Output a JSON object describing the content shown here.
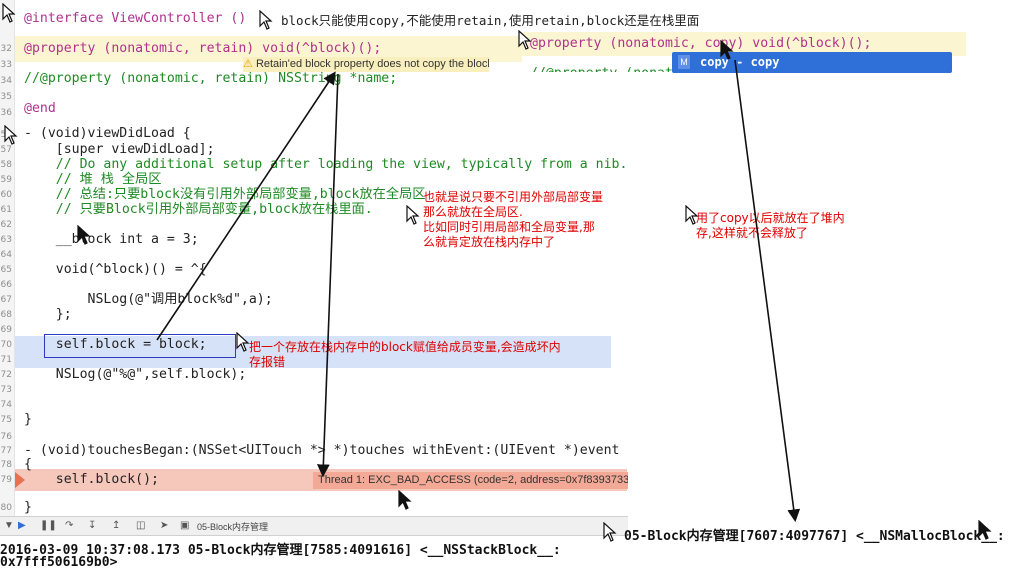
{
  "top_comment": "block只能使用copy,不能使用retain,使用retain,block还是在栈里面",
  "code_lines": {
    "l32": "@property (nonatomic, retain) void(^block)();",
    "l34": "//@property (nonatomic, retain) NSString *name;",
    "l36": "@end",
    "l56": "- (void)viewDidLoad {",
    "l57": "    [super viewDidLoad];",
    "l58": "    // Do any additional setup after loading the view, typically from a nib.",
    "l59": "    // 堆 栈 全局区",
    "l60": "    // 总结:只要block没有引用外部局部变量,block放在全局区",
    "l61": "    // 只要Block引用外部局部变量,block放在栈里面.",
    "l63": "    __block int a = 3;",
    "l65": "    void(^block)() = ^{",
    "l67": "        NSLog(@\"调用block%d\",a);",
    "l68": "    };",
    "l70": "    self.block = block;",
    "l72": "    NSLog(@\"%@\",self.block);",
    "l75": "}",
    "l77": "- (void)touchesBegan:(NSSet<UITouch *> *)touches withEvent:(UIEvent *)event",
    "l78": "{",
    "l79": "    self.block();",
    "l80": "}"
  },
  "interface_line": "@interface ViewController ()",
  "line_numbers": [
    "32",
    "33",
    "34",
    "35",
    "36",
    "56",
    "57",
    "58",
    "59",
    "60",
    "61",
    "62",
    "63",
    "64",
    "65",
    "66",
    "67",
    "68",
    "69",
    "70",
    "71",
    "72",
    "73",
    "74",
    "75",
    "76",
    "77",
    "78",
    "79",
    "80"
  ],
  "warning_text": "Retain'ed block property does not copy the block",
  "error_text": "Thread 1: EXC_BAD_ACCESS (code=2, address=0x7f83937330",
  "toolbar_target": "05-Block内存管理",
  "right_snippet": {
    "property_line": "@property (nonatomic, copy) void(^block)();",
    "second_line": "//@property (nonatomic, retain) NSString *name;",
    "autocomplete": "copy - copy",
    "autocomplete_badge": "M"
  },
  "notes": {
    "global_area": "也就是说只要不引用外部局部变量\n那么就放在全局区.\n比如同时引用局部和全局变量,那\n么就肯定放在栈内存中了",
    "stack_assign": "把一个存放在栈内存中的block赋值给成员变量,会造成坏内\n存报错",
    "heap_copy": "用了copy以后就放在了堆内\n存,这样就不会释放了"
  },
  "console": {
    "left_line1": "2016-03-09 10:37:08.173 05-Block内存管理[7585:4091616] <__NSStackBlock__:",
    "left_line2": "0x7fff506169b0>",
    "right_line": "05-Block内存管理[7607:4097767] <__NSMallocBlock__:"
  },
  "colors": {
    "note_red": "#e00000",
    "autocomplete_blue": "#2f6fd8",
    "error_bg": "#f6c8bb",
    "selection_blue": "#d6e2f8",
    "warning_bg": "#fbf5d1"
  }
}
